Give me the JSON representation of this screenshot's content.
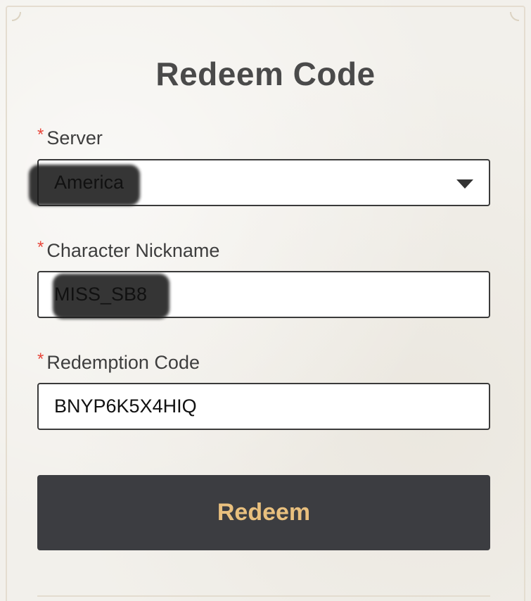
{
  "dialog": {
    "title": "Redeem Code"
  },
  "form": {
    "required_marker": "*",
    "server": {
      "label": "Server",
      "value": "America"
    },
    "nickname": {
      "label": "Character Nickname",
      "value": "MISS_SB8"
    },
    "code": {
      "label": "Redemption Code",
      "value": "BNYP6K5X4HIQ"
    }
  },
  "actions": {
    "redeem_label": "Redeem"
  },
  "icons": {
    "dropdown": "caret-down-icon"
  },
  "colors": {
    "button_bg": "#3c3d41",
    "button_text": "#e9c07e",
    "required": "#e8463a",
    "title": "#4a4a4a"
  }
}
